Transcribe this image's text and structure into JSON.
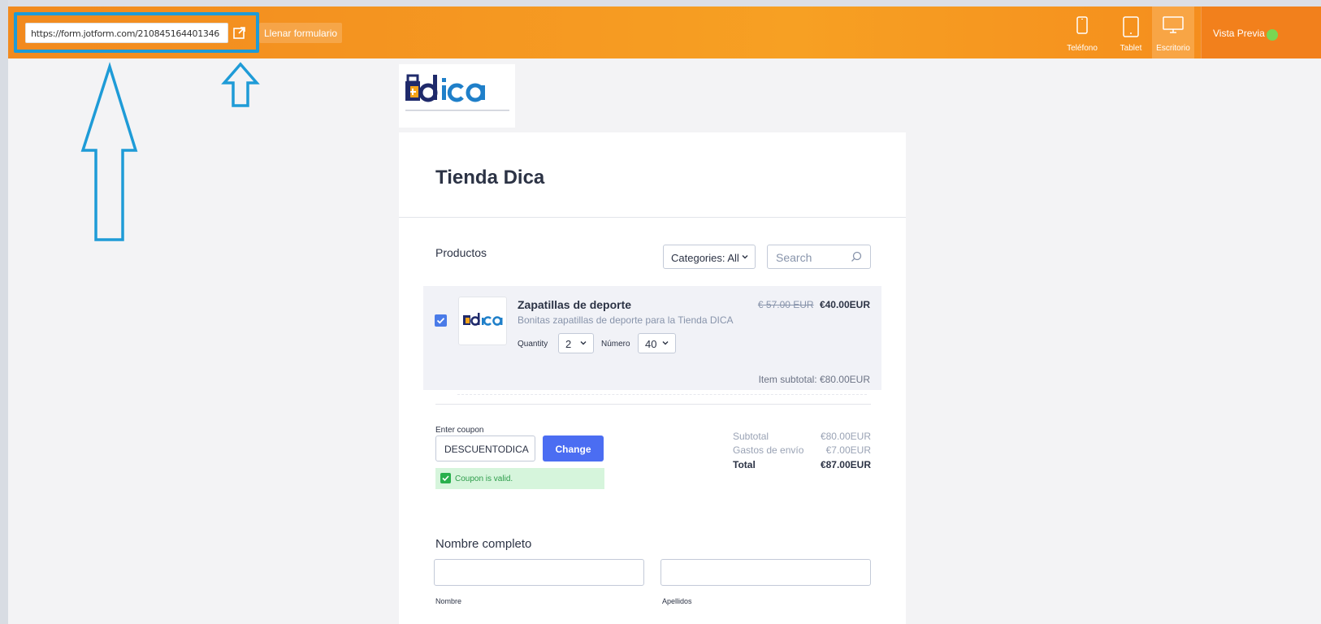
{
  "toolbar": {
    "url": "https://form.jotform.com/210845164401346",
    "fill_form_label": "Llenar formulario",
    "devices": [
      {
        "label": "Teléfono",
        "icon": "phone-icon"
      },
      {
        "label": "Tablet",
        "icon": "tablet-icon"
      },
      {
        "label": "Escritorio",
        "icon": "desktop-icon",
        "active": true
      }
    ],
    "preview_label": "Vista Previa"
  },
  "form": {
    "title": "Tienda Dica",
    "products_label": "Productos",
    "categories_value": "Categories: All",
    "search_placeholder": "Search",
    "product": {
      "name": "Zapatillas de deporte",
      "description": "Bonitas zapatillas de deporte para la Tienda DICA",
      "old_price": "€ 57.00 EUR",
      "price": "€40.00EUR",
      "quantity_label": "Quantity",
      "quantity_value": "2",
      "number_label": "Número",
      "number_value": "40",
      "item_subtotal": "Item subtotal:  €80.00EUR",
      "checked": true
    },
    "coupon": {
      "label": "Enter coupon",
      "value": "DESCUENTODICA",
      "button_label": "Change",
      "status": "Coupon is valid."
    },
    "summary": {
      "subtotal_label": "Subtotal",
      "subtotal_value": "€80.00EUR",
      "shipping_label": "Gastos de envío",
      "shipping_value": "€7.00EUR",
      "total_label": "Total",
      "total_value": "€87.00EUR"
    },
    "full_name": {
      "label": "Nombre completo",
      "first_sublabel": "Nombre",
      "last_sublabel": "Apellidos"
    }
  },
  "colors": {
    "toolbar_orange": "#f7931e",
    "annotation_blue": "#1e9bd7",
    "button_blue": "#4b6df2",
    "valid_green": "#29b04d"
  }
}
